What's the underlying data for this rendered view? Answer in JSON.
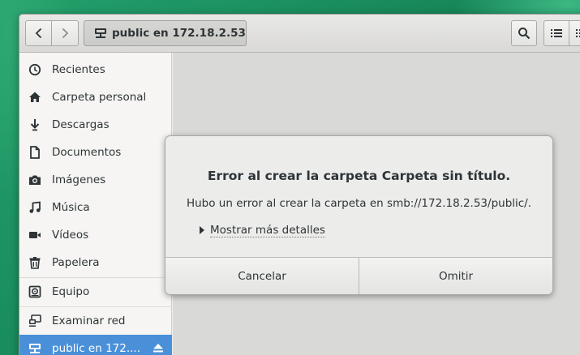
{
  "header": {
    "path_label": "public en 172.18.2.53"
  },
  "sidebar": {
    "items": [
      {
        "label": "Recientes",
        "icon": "clock-icon"
      },
      {
        "label": "Carpeta personal",
        "icon": "home-icon"
      },
      {
        "label": "Descargas",
        "icon": "download-icon"
      },
      {
        "label": "Documentos",
        "icon": "document-icon"
      },
      {
        "label": "Imágenes",
        "icon": "camera-icon"
      },
      {
        "label": "Música",
        "icon": "music-icon"
      },
      {
        "label": "Vídeos",
        "icon": "video-icon"
      },
      {
        "label": "Papelera",
        "icon": "trash-icon"
      },
      {
        "label": "Equipo",
        "icon": "drive-icon"
      },
      {
        "label": "Examinar red",
        "icon": "network-icon"
      },
      {
        "label": "public en 172....",
        "icon": "network-share-icon",
        "selected": true
      }
    ]
  },
  "dialog": {
    "title": "Error al crear la carpeta Carpeta sin título.",
    "message": "Hubo un error al crear la carpeta en smb://172.18.2.53/public/.",
    "expander_label": "Mostrar más detalles",
    "cancel_label": "Cancelar",
    "skip_label": "Omitir"
  },
  "colors": {
    "selection": "#4a90d9",
    "desktop": "#1a8a5e"
  }
}
